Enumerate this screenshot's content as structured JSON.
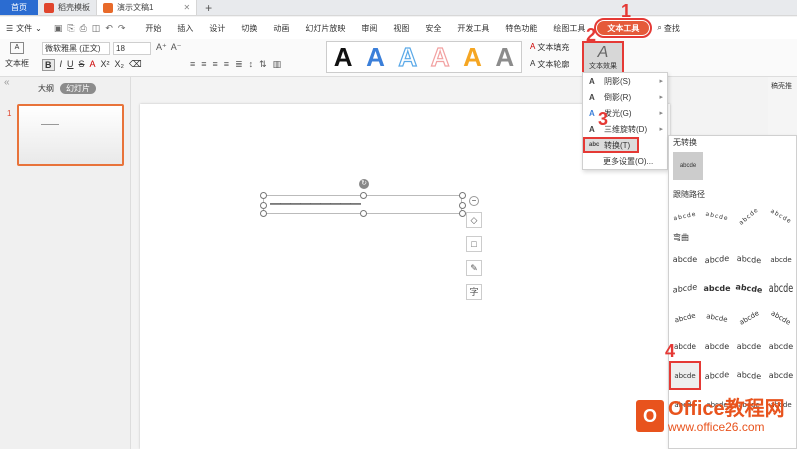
{
  "tabs": {
    "home": "首页",
    "template": "稻壳模板",
    "doc": "演示文稿1",
    "add": "+"
  },
  "menu": {
    "file": "文件",
    "items": [
      "开始",
      "插入",
      "设计",
      "切换",
      "动画",
      "幻灯片放映",
      "审阅",
      "视图",
      "安全",
      "开发工具",
      "特色功能",
      "绘图工具"
    ],
    "active": "文本工具",
    "search": "查找"
  },
  "ribbon": {
    "textbox": "文本框",
    "font": "微软雅黑 (正文)",
    "size": "18",
    "styles": [
      "A",
      "A",
      "A",
      "A",
      "A",
      "A"
    ],
    "style_colors": [
      "#111111",
      "#3b7fd9",
      "#5aa9e8",
      "#f2a1a1",
      "#f5a623",
      "#8c8c8c"
    ],
    "fill": "文本填充",
    "outline": "文本轮廓",
    "effect": "文本效果"
  },
  "left_panel": {
    "outline_tab": "大纲",
    "slide_tab": "幻灯片",
    "slide_number": "1"
  },
  "canvas": {
    "text": "—————————"
  },
  "dropdown": {
    "items": [
      {
        "icon": "A",
        "label": "阴影(S)"
      },
      {
        "icon": "A",
        "label": "倒影(R)"
      },
      {
        "icon": "A",
        "label": "发光(G)"
      },
      {
        "icon": "A",
        "label": "三维旋转(D)"
      },
      {
        "icon": "abc",
        "label": "转换(T)"
      }
    ],
    "more": "更多设置(O)..."
  },
  "gallery": {
    "none_label": "无转换",
    "none_sample": "abcde",
    "path_label": "跟随路径",
    "path_samples": [
      "abcde",
      "abcde",
      "abcde",
      "abcde"
    ],
    "warp_label": "弯曲",
    "warp_samples": [
      "abcde",
      "abcde",
      "abcde",
      "abcde",
      "abcde",
      "abcde",
      "abcde",
      "abcde",
      "abcde",
      "abcde",
      "abcde",
      "abcde",
      "abcde",
      "abcde",
      "abcde",
      "abcde",
      "abcde",
      "abcde",
      "abcde",
      "abcde",
      "abcde",
      "abcde",
      "abcde",
      "abcde"
    ]
  },
  "right_panel": {
    "label": "稿壳推"
  },
  "steps": [
    "1",
    "2",
    "3",
    "4"
  ],
  "watermark": {
    "brand": "Office教程网",
    "url": "www.office26.com"
  },
  "colors": {
    "accent": "#e53935",
    "brand": "#e8531d",
    "home_tab": "#2b6cd1"
  }
}
